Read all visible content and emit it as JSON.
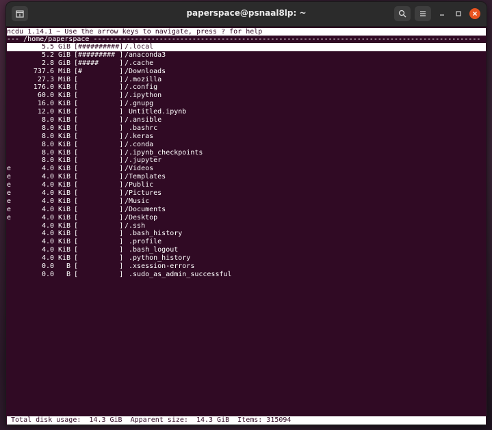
{
  "window": {
    "title": "paperspace@psnaal8lp: ~"
  },
  "ncdu": {
    "header": "ncdu 1.14.1 ~ Use the arrow keys to navigate, press ? for help",
    "path_line": "--- /home/paperspace ----------------------------------------------------------------------------------------------",
    "entries": [
      {
        "flag": "",
        "size": "5.5",
        "unit": "GiB",
        "bar": "[##########]",
        "name": "/.local",
        "selected": true
      },
      {
        "flag": "",
        "size": "5.2",
        "unit": "GiB",
        "bar": "[######### ]",
        "name": "/anaconda3",
        "selected": false
      },
      {
        "flag": "",
        "size": "2.8",
        "unit": "GiB",
        "bar": "[#####     ]",
        "name": "/.cache",
        "selected": false
      },
      {
        "flag": "",
        "size": "737.6",
        "unit": "MiB",
        "bar": "[#         ]",
        "name": "/Downloads",
        "selected": false
      },
      {
        "flag": "",
        "size": "27.3",
        "unit": "MiB",
        "bar": "[          ]",
        "name": "/.mozilla",
        "selected": false
      },
      {
        "flag": "",
        "size": "176.0",
        "unit": "KiB",
        "bar": "[          ]",
        "name": "/.config",
        "selected": false
      },
      {
        "flag": "",
        "size": "60.0",
        "unit": "KiB",
        "bar": "[          ]",
        "name": "/.ipython",
        "selected": false
      },
      {
        "flag": "",
        "size": "16.0",
        "unit": "KiB",
        "bar": "[          ]",
        "name": "/.gnupg",
        "selected": false
      },
      {
        "flag": "",
        "size": "12.0",
        "unit": "KiB",
        "bar": "[          ]",
        "name": " Untitled.ipynb",
        "selected": false
      },
      {
        "flag": "",
        "size": "8.0",
        "unit": "KiB",
        "bar": "[          ]",
        "name": "/.ansible",
        "selected": false
      },
      {
        "flag": "",
        "size": "8.0",
        "unit": "KiB",
        "bar": "[          ]",
        "name": " .bashrc",
        "selected": false
      },
      {
        "flag": "",
        "size": "8.0",
        "unit": "KiB",
        "bar": "[          ]",
        "name": "/.keras",
        "selected": false
      },
      {
        "flag": "",
        "size": "8.0",
        "unit": "KiB",
        "bar": "[          ]",
        "name": "/.conda",
        "selected": false
      },
      {
        "flag": "",
        "size": "8.0",
        "unit": "KiB",
        "bar": "[          ]",
        "name": "/.ipynb_checkpoints",
        "selected": false
      },
      {
        "flag": "",
        "size": "8.0",
        "unit": "KiB",
        "bar": "[          ]",
        "name": "/.jupyter",
        "selected": false
      },
      {
        "flag": "e",
        "size": "4.0",
        "unit": "KiB",
        "bar": "[          ]",
        "name": "/Videos",
        "selected": false
      },
      {
        "flag": "e",
        "size": "4.0",
        "unit": "KiB",
        "bar": "[          ]",
        "name": "/Templates",
        "selected": false
      },
      {
        "flag": "e",
        "size": "4.0",
        "unit": "KiB",
        "bar": "[          ]",
        "name": "/Public",
        "selected": false
      },
      {
        "flag": "e",
        "size": "4.0",
        "unit": "KiB",
        "bar": "[          ]",
        "name": "/Pictures",
        "selected": false
      },
      {
        "flag": "e",
        "size": "4.0",
        "unit": "KiB",
        "bar": "[          ]",
        "name": "/Music",
        "selected": false
      },
      {
        "flag": "e",
        "size": "4.0",
        "unit": "KiB",
        "bar": "[          ]",
        "name": "/Documents",
        "selected": false
      },
      {
        "flag": "e",
        "size": "4.0",
        "unit": "KiB",
        "bar": "[          ]",
        "name": "/Desktop",
        "selected": false
      },
      {
        "flag": "",
        "size": "4.0",
        "unit": "KiB",
        "bar": "[          ]",
        "name": "/.ssh",
        "selected": false
      },
      {
        "flag": "",
        "size": "4.0",
        "unit": "KiB",
        "bar": "[          ]",
        "name": " .bash_history",
        "selected": false
      },
      {
        "flag": "",
        "size": "4.0",
        "unit": "KiB",
        "bar": "[          ]",
        "name": " .profile",
        "selected": false
      },
      {
        "flag": "",
        "size": "4.0",
        "unit": "KiB",
        "bar": "[          ]",
        "name": " .bash_logout",
        "selected": false
      },
      {
        "flag": "",
        "size": "4.0",
        "unit": "KiB",
        "bar": "[          ]",
        "name": " .python_history",
        "selected": false
      },
      {
        "flag": "",
        "size": "0.0",
        "unit": "B",
        "bar": "[          ]",
        "name": " .xsession-errors",
        "selected": false
      },
      {
        "flag": "",
        "size": "0.0",
        "unit": "B",
        "bar": "[          ]",
        "name": " .sudo_as_admin_successful",
        "selected": false
      }
    ],
    "footer": " Total disk usage:  14.3 GiB  Apparent size:  14.3 GiB  Items: 315094"
  },
  "icons": {
    "new_tab": "new-tab-icon",
    "search": "search-icon",
    "menu": "hamburger-menu-icon",
    "minimize": "minimize-icon",
    "maximize": "maximize-icon",
    "close": "close-icon"
  },
  "colors": {
    "terminal_bg": "#300a24",
    "titlebar_bg": "#2b2b2b",
    "close_button": "#e95420"
  }
}
